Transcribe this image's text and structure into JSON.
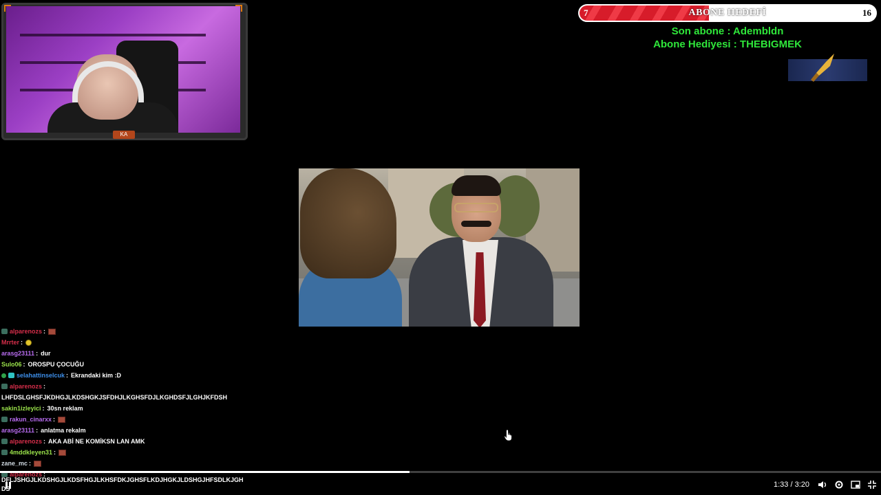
{
  "webcam": {
    "logo_text": "KA"
  },
  "goal": {
    "current": "7",
    "title": "ABONE HEDEFİ",
    "target": "16",
    "progress_fraction": 0.4375,
    "last_sub_label": "Son abone : Adembldn",
    "gift_label": "Abone Hediyesi : THEBIGMEK"
  },
  "chat": [
    {
      "badge": "sq",
      "user": "alparenozs",
      "color": "#d62e4a",
      "text": "",
      "emote": "brick"
    },
    {
      "badge": "",
      "user": "Mrrter",
      "color": "#d62e4a",
      "text": "",
      "emote": "yellow"
    },
    {
      "badge": "",
      "user": "arasg23111",
      "color": "#b86cf0",
      "text": "dur",
      "emote": ""
    },
    {
      "badge": "",
      "user": "Sulo06",
      "color": "#9ae24a",
      "text": "OROSPU ÇOCUĞU",
      "emote": ""
    },
    {
      "badge": "multi",
      "user": "selahattinselcuk",
      "color": "#3d8ee8",
      "text": "Ekrandaki kim :D",
      "emote": ""
    },
    {
      "badge": "sq",
      "user": "alparenozs",
      "color": "#d62e4a",
      "text": "",
      "emote": ""
    },
    {
      "badge": "",
      "user": "",
      "color": "#fff",
      "text": "LHFDSLGHSFJKDHGJLKDSHGKJSFDHJLKGHSFDJLKGHDSFJLGHJKFDSH",
      "emote": ""
    },
    {
      "badge": "",
      "user": "sakin1izleyici",
      "color": "#9ae24a",
      "text": "30sn reklam",
      "emote": ""
    },
    {
      "badge": "sq",
      "user": "rakun_cinarxx",
      "color": "#b86cf0",
      "text": "",
      "emote": "brick"
    },
    {
      "badge": "",
      "user": "arasg23111",
      "color": "#b86cf0",
      "text": "anlatma rekalm",
      "emote": ""
    },
    {
      "badge": "sq",
      "user": "alparenozs",
      "color": "#d62e4a",
      "text": "AKA ABİ NE KOMİKSN LAN AMK",
      "emote": ""
    },
    {
      "badge": "sq",
      "user": "4mddkleyen31",
      "color": "#9ae24a",
      "text": "",
      "emote": "brick"
    },
    {
      "badge": "",
      "user": "zane_mc",
      "color": "#cfd8e0",
      "text": "",
      "emote": "brick"
    },
    {
      "badge": "sq",
      "user": "alparenozs",
      "color": "#d62e4a",
      "text": "",
      "emote": ""
    }
  ],
  "bottom_text_1": "DFLJSHGJLKDSHGJLKDSFHGJLKHSFDKJGHSFLKDJHGKJLDSHGJHFSDLKJGH",
  "bottom_text_2": "DS",
  "player": {
    "time": "1:33 / 3:20",
    "progress_fraction": 0.465
  }
}
